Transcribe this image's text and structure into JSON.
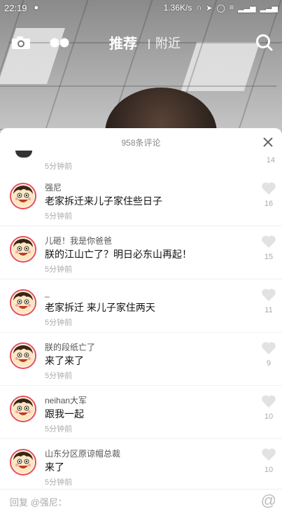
{
  "status_bar": {
    "time": "22:19",
    "net_speed": "1.36K/s"
  },
  "top_nav": {
    "tabs": [
      {
        "label": "推荐",
        "active": true
      },
      {
        "label": "附近",
        "active": false
      }
    ],
    "icons": [
      "camera-icon",
      "dots-icon",
      "search-icon"
    ]
  },
  "comments_panel": {
    "count_label": "958条评论",
    "partial_item": {
      "time": "5分钟前",
      "likes": "14"
    },
    "items": [
      {
        "user": "强尼",
        "text": "老家拆迁来儿子家住些日子",
        "time": "5分钟前",
        "likes": "16"
      },
      {
        "user": "儿砸！我是你爸爸",
        "text": "朕的江山亡了？明日必东山再起！",
        "time": "5分钟前",
        "likes": "15"
      },
      {
        "user": "_",
        "text": "老家拆迁 来儿子家住两天",
        "time": "5分钟前",
        "likes": "11"
      },
      {
        "user": "朕的段纸亡了",
        "text": "来了来了",
        "time": "5分钟前",
        "likes": "9"
      },
      {
        "user": "neihan大军",
        "text": "跟我一起",
        "time": "5分钟前",
        "likes": "10"
      },
      {
        "user": "山东分区原谅帽总裁",
        "text": "来了",
        "time": "5分钟前",
        "likes": "10"
      }
    ],
    "reply_placeholder": "回复 @强尼："
  }
}
